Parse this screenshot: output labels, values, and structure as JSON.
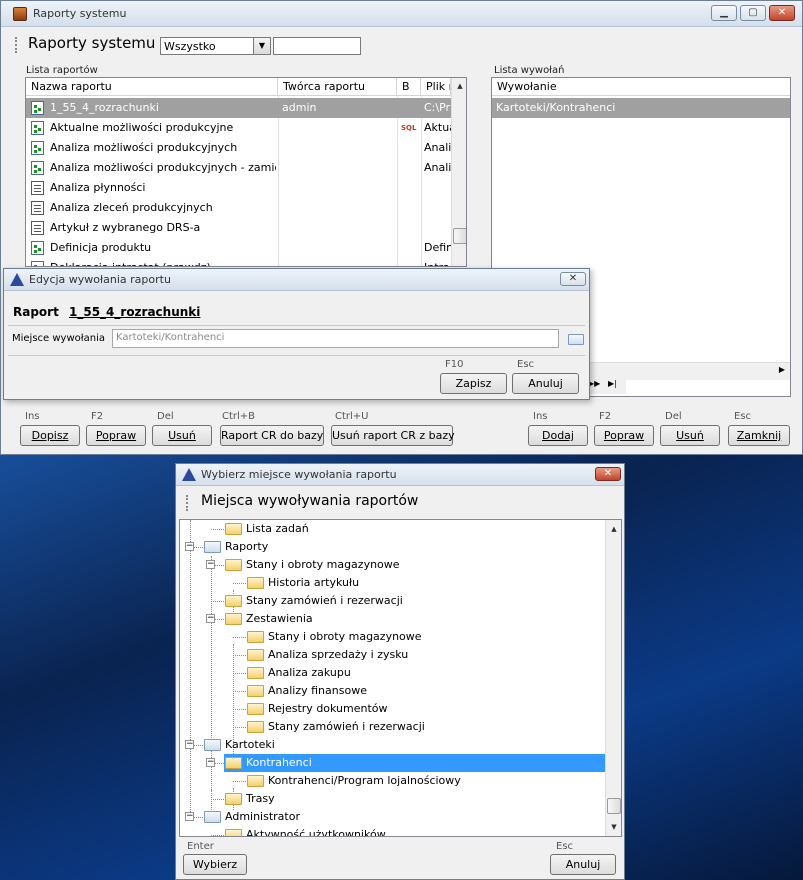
{
  "main_window": {
    "title": "Raporty systemu",
    "toolbar_title": "Raporty systemu",
    "filter": {
      "selected": "Wszystko"
    },
    "search": {
      "value": ""
    },
    "report_list": {
      "label": "Lista raportów",
      "columns": [
        "Nazwa raportu",
        "Twórca raportu",
        "B",
        "Plik r"
      ],
      "rows": [
        {
          "name": "1_55_4_rozrachunki",
          "creator": "admin",
          "b": "",
          "file": "C:\\Pr",
          "icon": "report-icon"
        },
        {
          "name": "Aktualne możliwości produkcyjne",
          "creator": "",
          "b": "SQL",
          "file": "Aktua",
          "icon": "report-icon"
        },
        {
          "name": "Analiza możliwości produkcyjnych",
          "creator": "",
          "b": "",
          "file": "Anali",
          "icon": "report-icon"
        },
        {
          "name": "Analiza możliwości produkcyjnych - zamienniki",
          "creator": "",
          "b": "",
          "file": "Anali",
          "icon": "report-icon"
        },
        {
          "name": "Analiza płynności",
          "creator": "",
          "b": "",
          "file": "",
          "icon": "document-icon"
        },
        {
          "name": "Analiza zleceń produkcyjnych",
          "creator": "",
          "b": "",
          "file": "",
          "icon": "document-icon"
        },
        {
          "name": "Artykuł z wybranego DRS-a",
          "creator": "",
          "b": "",
          "file": "",
          "icon": "document-icon"
        },
        {
          "name": "Definicja produktu",
          "creator": "",
          "b": "",
          "file": "Defin",
          "icon": "report-icon"
        },
        {
          "name": "Deklaracja intrastat (prawdz)",
          "creator": "",
          "b": "",
          "file": "Intra",
          "icon": "report-icon"
        }
      ]
    },
    "call_list": {
      "label": "Lista wywołań",
      "column": "Wywołanie",
      "rows": [
        "Kartoteki/Kontrahenci"
      ]
    },
    "left_buttons": [
      {
        "hint": "Ins",
        "label": "Dopisz"
      },
      {
        "hint": "F2",
        "label": "Popraw"
      },
      {
        "hint": "Del",
        "label": "Usuń"
      },
      {
        "hint": "Ctrl+B",
        "label": "Raport CR do bazy"
      },
      {
        "hint": "Ctrl+U",
        "label": "Usuń raport CR z bazy"
      }
    ],
    "right_buttons": [
      {
        "hint": "Ins",
        "label": "Dodaj"
      },
      {
        "hint": "F2",
        "label": "Popraw"
      },
      {
        "hint": "Del",
        "label": "Usuń"
      },
      {
        "hint": "Esc",
        "label": "Zamknij"
      }
    ]
  },
  "edit_dialog": {
    "title": "Edycja wywołania raportu",
    "report_label": "Raport",
    "report_name": "1_55_4_rozrachunki",
    "location_label": "Miejsce wywołania",
    "location_value": "Kartoteki/Kontrahenci",
    "save": {
      "hint": "F10",
      "label": "Zapisz"
    },
    "cancel": {
      "hint": "Esc",
      "label": "Anuluj"
    }
  },
  "select_dialog": {
    "title": "Wybierz miejsce wywołania raportu",
    "heading": "Miejsca wywoływania raportów",
    "tree": [
      {
        "label": "Lista zadań",
        "level": 1,
        "expander": "",
        "selected": false
      },
      {
        "label": "Raporty",
        "level": 0,
        "expander": "−",
        "selected": false
      },
      {
        "label": "Stany i obroty magazynowe",
        "level": 1,
        "expander": "−",
        "selected": false
      },
      {
        "label": "Historia artykułu",
        "level": 2,
        "expander": "",
        "selected": false
      },
      {
        "label": "Stany zamówień i rezerwacji",
        "level": 1,
        "expander": "",
        "selected": false
      },
      {
        "label": "Zestawienia",
        "level": 1,
        "expander": "−",
        "selected": false
      },
      {
        "label": "Stany i obroty magazynowe",
        "level": 2,
        "expander": "",
        "selected": false
      },
      {
        "label": "Analiza sprzedaży i zysku",
        "level": 2,
        "expander": "",
        "selected": false
      },
      {
        "label": "Analiza zakupu",
        "level": 2,
        "expander": "",
        "selected": false
      },
      {
        "label": "Analizy finansowe",
        "level": 2,
        "expander": "",
        "selected": false
      },
      {
        "label": "Rejestry dokumentów",
        "level": 2,
        "expander": "",
        "selected": false
      },
      {
        "label": "Stany zamówień i rezerwacji",
        "level": 2,
        "expander": "",
        "selected": false
      },
      {
        "label": "Kartoteki",
        "level": 0,
        "expander": "−",
        "selected": false
      },
      {
        "label": "Kontrahenci",
        "level": 1,
        "expander": "−",
        "selected": true
      },
      {
        "label": "Kontrahenci/Program lojalnościowy",
        "level": 2,
        "expander": "",
        "selected": false
      },
      {
        "label": "Trasy",
        "level": 1,
        "expander": "",
        "selected": false
      },
      {
        "label": "Administrator",
        "level": 0,
        "expander": "−",
        "selected": false
      },
      {
        "label": "Aktywność użytkowników",
        "level": 1,
        "expander": "",
        "selected": false
      }
    ],
    "select": {
      "hint": "Enter",
      "label": "Wybierz"
    },
    "cancel": {
      "hint": "Esc",
      "label": "Anuluj"
    }
  }
}
